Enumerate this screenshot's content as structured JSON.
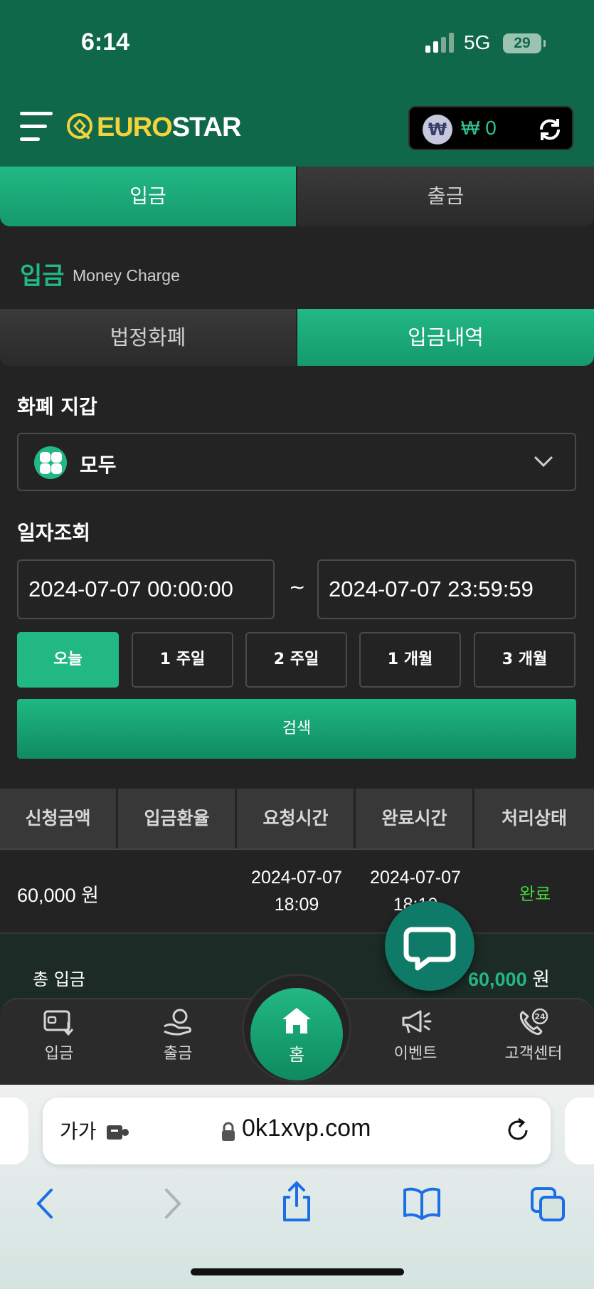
{
  "status": {
    "time": "6:14",
    "network": "5G",
    "battery": "29"
  },
  "header": {
    "logo": {
      "brand_yellow": "EURO",
      "brand_white": "STAR"
    },
    "wallet": {
      "currency_symbol": "₩",
      "balance": "₩ 0"
    }
  },
  "main_tabs": [
    {
      "label": "입금",
      "active": true
    },
    {
      "label": "출금",
      "active": false
    }
  ],
  "section": {
    "title": "입금",
    "subtitle": "Money Charge"
  },
  "sub_tabs": [
    {
      "label": "법정화폐",
      "active": false
    },
    {
      "label": "입금내역",
      "active": true
    }
  ],
  "filters": {
    "wallet_label": "화폐 지갑",
    "wallet_selected": "모두",
    "date_label": "일자조회",
    "date_from": "2024-07-07 00:00:00",
    "date_to": "2024-07-07 23:59:59",
    "separator": "~",
    "periods": [
      {
        "label": "오늘",
        "active": true
      },
      {
        "label": "1 주일",
        "active": false
      },
      {
        "label": "2 주일",
        "active": false
      },
      {
        "label": "1 개월",
        "active": false
      },
      {
        "label": "3 개월",
        "active": false
      }
    ],
    "search_label": "검색"
  },
  "table": {
    "columns": [
      "신청금액",
      "입금환율",
      "요청시간",
      "완료시간",
      "처리상태"
    ],
    "rows": [
      {
        "amount": "60,000 원",
        "rate": "",
        "request_date": "2024-07-07",
        "request_time": "18:09",
        "complete_date": "2024-07-07",
        "complete_time": "18:10",
        "status": "완료"
      }
    ]
  },
  "total": {
    "label": "총 입금",
    "value": "60,000",
    "unit": "원"
  },
  "bottom_nav": [
    {
      "label": "입금",
      "icon": "deposit-icon"
    },
    {
      "label": "출금",
      "icon": "withdraw-icon"
    },
    {
      "label": "홈",
      "icon": "home-icon"
    },
    {
      "label": "이벤트",
      "icon": "megaphone-icon"
    },
    {
      "label": "고객센터",
      "icon": "support-24-icon"
    }
  ],
  "browser": {
    "text_size": "가가",
    "url": "0k1xvp.com"
  },
  "colors": {
    "accent": "#22b884",
    "header": "#10684a",
    "brand_yellow": "#f4d23b",
    "status_done": "#49d23c"
  }
}
